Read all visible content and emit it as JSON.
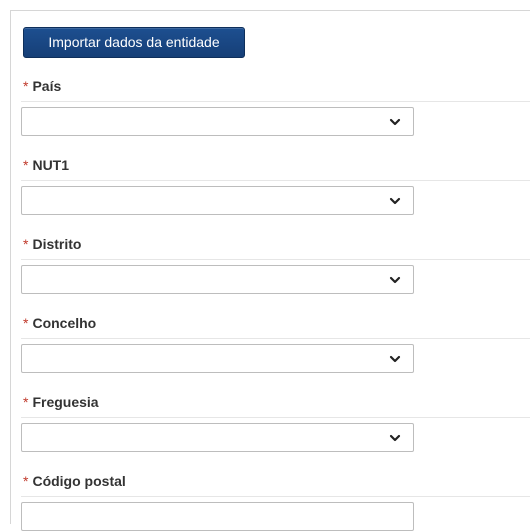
{
  "import_button": {
    "label": "Importar dados da entidade"
  },
  "required_marker": "*",
  "fields": [
    {
      "label": "País",
      "value": "",
      "icon": "chevron-down-icon"
    },
    {
      "label": "NUT1",
      "value": "",
      "icon": "chevron-down-icon"
    },
    {
      "label": "Distrito",
      "value": "",
      "icon": "chevron-down-icon"
    },
    {
      "label": "Concelho",
      "value": "",
      "icon": "chevron-down-icon"
    },
    {
      "label": "Freguesia",
      "value": "",
      "icon": "chevron-down-icon"
    },
    {
      "label": "Código postal",
      "value": ""
    }
  ],
  "colors": {
    "button_bg": "#1d4f90",
    "required": "#c0392b",
    "label": "#333333",
    "border": "#bdbdbd"
  }
}
